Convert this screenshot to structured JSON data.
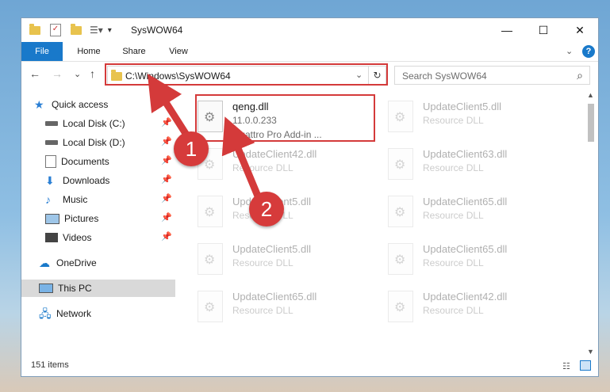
{
  "window": {
    "title": "SysWOW64",
    "controls": {
      "minimize": "—",
      "maximize": "☐",
      "close": "✕"
    }
  },
  "ribbon": {
    "tabs": [
      "File",
      "Home",
      "Share",
      "View"
    ],
    "help": "?"
  },
  "nav": {
    "back": "←",
    "forward": "→",
    "recent": "⌄",
    "up": "↑",
    "address": "C:\\Windows\\SysWOW64",
    "dropdown": "⌄",
    "refresh": "↻",
    "search_placeholder": "Search SysWOW64",
    "search_icon": "⌕"
  },
  "sidebar": {
    "items": [
      {
        "label": "Quick access",
        "icon": "star-icon",
        "pinned": false
      },
      {
        "label": "Local Disk (C:)",
        "icon": "drive-icon",
        "pinned": true
      },
      {
        "label": "Local Disk (D:)",
        "icon": "drive-icon",
        "pinned": true
      },
      {
        "label": "Documents",
        "icon": "documents-icon",
        "pinned": true
      },
      {
        "label": "Downloads",
        "icon": "download-icon",
        "pinned": true
      },
      {
        "label": "Music",
        "icon": "music-icon",
        "pinned": true
      },
      {
        "label": "Pictures",
        "icon": "pictures-icon",
        "pinned": true
      },
      {
        "label": "Videos",
        "icon": "videos-icon",
        "pinned": true
      },
      {
        "label": "OneDrive",
        "icon": "cloud-icon",
        "pinned": false
      },
      {
        "label": "This PC",
        "icon": "pc-icon",
        "pinned": false
      },
      {
        "label": "Network",
        "icon": "network-icon",
        "pinned": false
      }
    ],
    "pin_glyph": "📌"
  },
  "files": {
    "highlighted": {
      "name": "qeng.dll",
      "version": "11.0.0.233",
      "description": "Quattro Pro Add-in ..."
    },
    "faded": [
      {
        "name": "UpdateClient5.dll",
        "type": "Resource DLL"
      },
      {
        "name": "UpdateClient42.dll",
        "type": "Resource DLL"
      },
      {
        "name": "UpdateClient63.dll",
        "type": "Resource DLL"
      },
      {
        "name": "UpdateClient5.dll",
        "type": "Resource DLL"
      },
      {
        "name": "UpdateClient65.dll",
        "type": "Resource DLL"
      },
      {
        "name": "UpdateClient5.dll",
        "type": "Resource DLL"
      },
      {
        "name": "UpdateClient65.dll",
        "type": "Resource DLL"
      },
      {
        "name": "UpdateClient65.dll",
        "type": "Resource DLL"
      },
      {
        "name": "UpdateClient42.dll",
        "type": "Resource DLL"
      }
    ]
  },
  "status": {
    "count": "151 items"
  },
  "annotations": {
    "step1": "1",
    "step2": "2"
  },
  "colors": {
    "accent": "#1979ca",
    "annotation": "#d43a3a"
  }
}
